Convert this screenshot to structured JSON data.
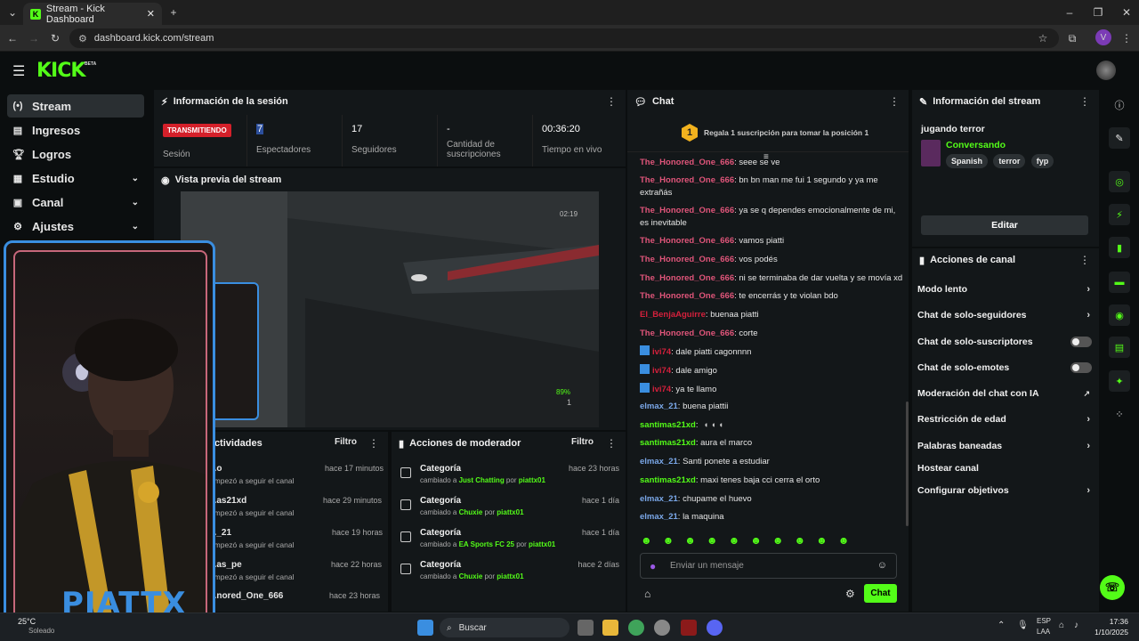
{
  "browser": {
    "tab_title": "Stream - Kick Dashboard",
    "url": "dashboard.kick.com/stream",
    "profile_initial": "V"
  },
  "kick": {
    "logo": "KICK",
    "beta": "BETA"
  },
  "nav": {
    "items": [
      {
        "label": "Stream",
        "icon": "stream-icon"
      },
      {
        "label": "Ingresos",
        "icon": "money-icon"
      },
      {
        "label": "Logros",
        "icon": "trophy-icon"
      },
      {
        "label": "Estudio",
        "icon": "studio-icon"
      },
      {
        "label": "Canal",
        "icon": "channel-icon"
      },
      {
        "label": "Ajustes",
        "icon": "gear-icon"
      }
    ]
  },
  "session": {
    "title": "Información de la sesión",
    "live_badge": "TRANSMITIENDO",
    "session_label": "Sesión",
    "viewers_value": "7",
    "viewers_label": "Espectadores",
    "followers_value": "17",
    "followers_label": "Seguidores",
    "subs_value": "-",
    "subs_label": "Cantidad de suscripciones",
    "live_time_value": "00:36:20",
    "live_time_label": "Tiempo en vivo"
  },
  "preview": {
    "title": "Vista previa del stream",
    "overlay_time": "02:19",
    "overlay_pct": "89%",
    "overlay_num": "1",
    "cam_name": "PIATTX"
  },
  "activities": {
    "title": "Actividades",
    "filter": "Filtro",
    "rows": [
      {
        "name": "...o",
        "sub": "Empezó a seguir el canal",
        "time": "hace 17 minutos"
      },
      {
        "name": "...as21xd",
        "sub": "Empezó a seguir el canal",
        "time": "hace 29 minutos"
      },
      {
        "name": "..._21",
        "sub": "Empezó a seguir el canal",
        "time": "hace 19 horas"
      },
      {
        "name": "...as_pe",
        "sub": "Empezó a seguir el canal",
        "time": "hace 22 horas"
      },
      {
        "name": "...nored_One_666",
        "sub": "",
        "time": "hace 23 horas"
      }
    ]
  },
  "mod_actions": {
    "title": "Acciones de moderador",
    "filter": "Filtro",
    "rows": [
      {
        "title": "Categoría",
        "prefix": "cambiado a ",
        "category": "Just Chatting",
        "por": " por ",
        "user": "piattx01",
        "time": "hace 23 horas"
      },
      {
        "title": "Categoría",
        "prefix": "cambiado a ",
        "category": "Chuxie",
        "por": " por ",
        "user": "piattx01",
        "time": "hace 1 día"
      },
      {
        "title": "Categoría",
        "prefix": "cambiado a ",
        "category": "EA Sports FC 25",
        "por": " por ",
        "user": "piattx01",
        "time": "hace 1 día"
      },
      {
        "title": "Categoría",
        "prefix": "cambiado a ",
        "category": "Chuxie",
        "por": " por ",
        "user": "piattx01",
        "time": "hace 2 días"
      }
    ]
  },
  "chat": {
    "title": "Chat",
    "rank_number": "1",
    "gift_banner": "Regala 1 suscripción para tomar la posición 1",
    "input_placeholder": "Enviar un mensaje",
    "send_label": "Chat",
    "messages": [
      {
        "user": "The_Honored_One_666",
        "color": "#e0557a",
        "text": ": seee se ve"
      },
      {
        "user": "The_Honored_One_666",
        "color": "#e0557a",
        "text": ": bn bn man me fui 1 segundo y ya me extrañás"
      },
      {
        "user": "The_Honored_One_666",
        "color": "#e0557a",
        "text": ": ya se q dependes emocionalmente de mi, es inevitable"
      },
      {
        "user": "The_Honored_One_666",
        "color": "#e0557a",
        "text": ": vamos piatti"
      },
      {
        "user": "The_Honored_One_666",
        "color": "#e0557a",
        "text": ": vos podés"
      },
      {
        "user": "The_Honored_One_666",
        "color": "#e0557a",
        "text": ": ni se terminaba de dar vuelta y se movía xd"
      },
      {
        "user": "The_Honored_One_666",
        "color": "#e0557a",
        "text": ": te encerrás y te violan bdo"
      },
      {
        "user": "El_BenjaAguirre",
        "color": "#d4203c",
        "text": ": buenaa piatti"
      },
      {
        "user": "The_Honored_One_666",
        "color": "#e0557a",
        "text": ": corte"
      },
      {
        "user": "ivi74",
        "color": "#d4203c",
        "text": ": dale piatti cagonnnn"
      },
      {
        "user": "ivi74",
        "color": "#d4203c",
        "text": ": dale amigo"
      },
      {
        "user": "ivi74",
        "color": "#d4203c",
        "text": ": ya te llamo"
      },
      {
        "user": "elmax_21",
        "color": "#7aa7e8",
        "text": ": buena piattii"
      },
      {
        "user": "santimas21xd",
        "color": "#53fc18",
        "text": ":"
      },
      {
        "user": "santimas21xd",
        "color": "#53fc18",
        "text": ": aura el marco"
      },
      {
        "user": "elmax_21",
        "color": "#7aa7e8",
        "text": ": Santi ponete a estudiar"
      },
      {
        "user": "santimas21xd",
        "color": "#53fc18",
        "text": ": maxi tenes baja cci cerra el orto"
      },
      {
        "user": "elmax_21",
        "color": "#7aa7e8",
        "text": ": chupame el huevo"
      },
      {
        "user": "elmax_21",
        "color": "#7aa7e8",
        "text": ": la maquina"
      }
    ]
  },
  "stream_info": {
    "title": "Información del stream",
    "stream_title": "jugando terror",
    "category": "Conversando",
    "tags": [
      "Spanish",
      "terror",
      "fyp"
    ],
    "edit": "Editar"
  },
  "channel_actions": {
    "title": "Acciones de canal",
    "items": [
      {
        "label": "Modo lento",
        "kind": "arrow"
      },
      {
        "label": "Chat de solo-seguidores",
        "kind": "arrow"
      },
      {
        "label": "Chat de solo-suscriptores",
        "kind": "toggle"
      },
      {
        "label": "Chat de solo-emotes",
        "kind": "toggle"
      },
      {
        "label": "Moderación del chat con IA",
        "kind": "external"
      },
      {
        "label": "Restricción de edad",
        "kind": "arrow"
      },
      {
        "label": "Palabras baneadas",
        "kind": "arrow"
      },
      {
        "label": "Hostear canal",
        "kind": "none"
      },
      {
        "label": "Configurar objetivos",
        "kind": "arrow"
      }
    ]
  },
  "taskbar": {
    "search": "Buscar",
    "weather_temp": "25°C",
    "weather_desc": "Soleado",
    "lang1": "ESP",
    "lang2": "LAA",
    "time": "17:36",
    "date": "1/10/2025"
  },
  "colors": {
    "kick_green": "#53fc18",
    "live_red": "#d4202a",
    "panel": "#131719"
  }
}
